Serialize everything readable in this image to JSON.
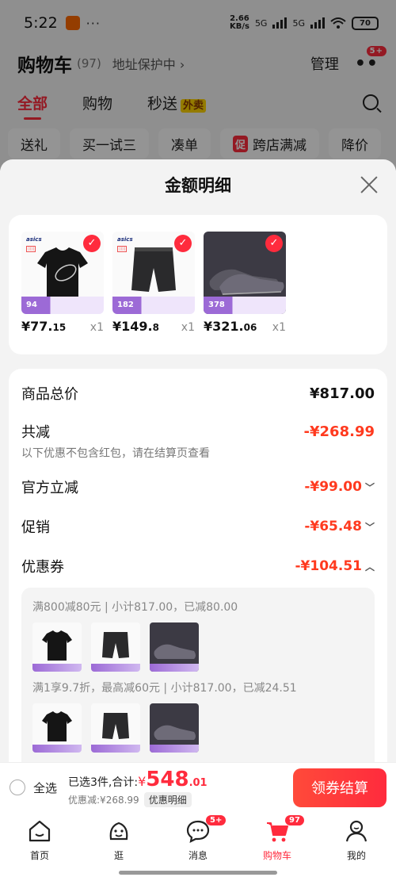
{
  "status_bar": {
    "time": "5:22",
    "dots": "···",
    "speed_value": "2.66",
    "speed_unit": "KB/s",
    "signal1": "5G",
    "signal2": "5G",
    "battery": "70"
  },
  "cart_header": {
    "title": "购物车",
    "count": "(97)",
    "address": "地址保护中 ›",
    "manage": "管理",
    "more_icon": "more-dots-icon",
    "more_badge": "5+"
  },
  "cart_tabs": [
    {
      "label": "全部",
      "active": true
    },
    {
      "label": "购物",
      "active": false
    },
    {
      "label": "秒送",
      "badge": "外卖",
      "active": false
    }
  ],
  "cart_filters": [
    "送礼",
    "买一试三",
    "凑单",
    "跨店满减",
    "降价"
  ],
  "filter_badge": "促",
  "sheet": {
    "title": "金额明细",
    "close_icon": "close-icon"
  },
  "products": [
    {
      "brand": "asics",
      "strip": "94",
      "price": "¥77.",
      "price_dec": "15",
      "qty": "x1"
    },
    {
      "brand": "asics",
      "strip": "182",
      "price": "¥149.",
      "price_dec": "8",
      "qty": "x1"
    },
    {
      "brand": "",
      "strip": "378",
      "price": "¥321.",
      "price_dec": "06",
      "qty": "x1"
    }
  ],
  "summary": {
    "total_label": "商品总价",
    "total_value": "¥817.00",
    "discount_label": "共减",
    "discount_value": "-¥268.99",
    "discount_note": "以下优惠不包含红包，请在结算页查看",
    "official_label": "官方立减",
    "official_value": "-¥99.00",
    "promo_label": "促销",
    "promo_value": "-¥65.48",
    "coupon_label": "优惠券",
    "coupon_value": "-¥104.51"
  },
  "coupon_details": [
    {
      "text": "满800减80元 | 小计817.00，已减80.00"
    },
    {
      "text": "满1享9.7折，最高减60元 | 小计817.00，已减24.51"
    }
  ],
  "checkout": {
    "select_all": "全选",
    "selected_text": "已选3件,合计:",
    "yen": "¥",
    "amount": "548",
    "amount_dec": ".01",
    "saved": "优惠减:¥268.99",
    "detail_button": "优惠明细",
    "checkout_button": "领券结算"
  },
  "bottom_nav": [
    {
      "label": "首页",
      "icon": "home-icon"
    },
    {
      "label": "逛",
      "icon": "browse-icon"
    },
    {
      "label": "消息",
      "icon": "message-icon",
      "badge": "5+"
    },
    {
      "label": "购物车",
      "icon": "cart-icon",
      "badge": "97",
      "active": true
    },
    {
      "label": "我的",
      "icon": "profile-icon"
    }
  ],
  "colors": {
    "accent": "#ff2b3d",
    "discount": "#ff3a1f",
    "strip": "#9c6ad6"
  }
}
